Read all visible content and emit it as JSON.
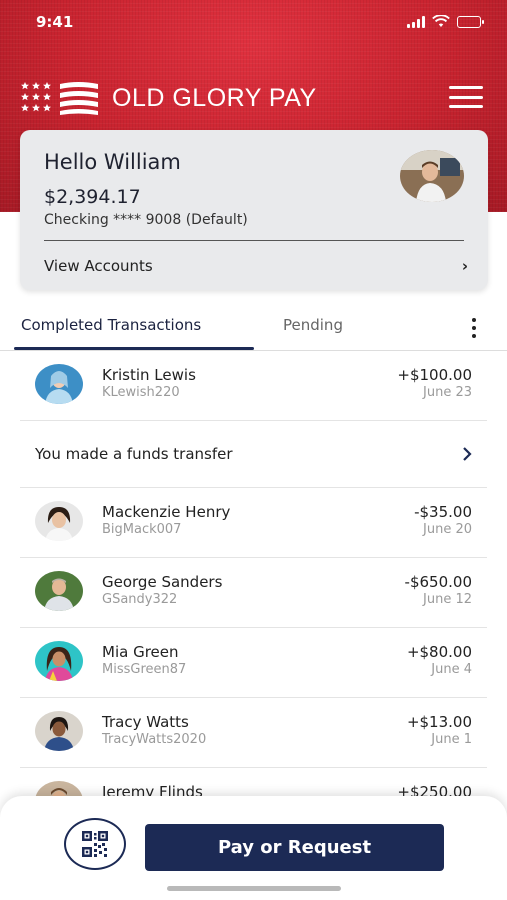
{
  "status_bar": {
    "time": "9:41"
  },
  "brand": {
    "title": "OLD GLORY PAY"
  },
  "account": {
    "greeting": "Hello William",
    "balance": "$2,394.17",
    "account_line": "Checking **** 9008 (Default)",
    "view_accounts_label": "View Accounts"
  },
  "tabs": [
    {
      "label": "Completed Transactions",
      "active": true
    },
    {
      "label": "Pending",
      "active": false
    }
  ],
  "transactions": [
    {
      "name": "Kristin Lewis",
      "handle": "KLewish220",
      "amount": "+$100.00",
      "date": "June 23"
    },
    {
      "name": "Mackenzie Henry",
      "handle": "BigMack007",
      "amount": "-$35.00",
      "date": "June 20"
    },
    {
      "name": "George Sanders",
      "handle": "GSandy322",
      "amount": "-$650.00",
      "date": "June 12"
    },
    {
      "name": "Mia Green",
      "handle": "MissGreen87",
      "amount": "+$80.00",
      "date": "June 4"
    },
    {
      "name": "Tracy Watts",
      "handle": "TracyWatts2020",
      "amount": "+$13.00",
      "date": "June 1"
    },
    {
      "name": "Jeremy Flinds",
      "handle": "",
      "amount": "+$250.00",
      "date": ""
    }
  ],
  "funds_transfer": {
    "label": "You made a funds transfer"
  },
  "actions": {
    "pay_request_label": "Pay or Request"
  },
  "colors": {
    "brand_red": "#c8232f",
    "navy": "#1c2a55"
  },
  "icons": [
    "flag-logo-icon",
    "menu-icon",
    "chevron-right-icon",
    "more-vertical-icon",
    "qr-code-icon"
  ]
}
